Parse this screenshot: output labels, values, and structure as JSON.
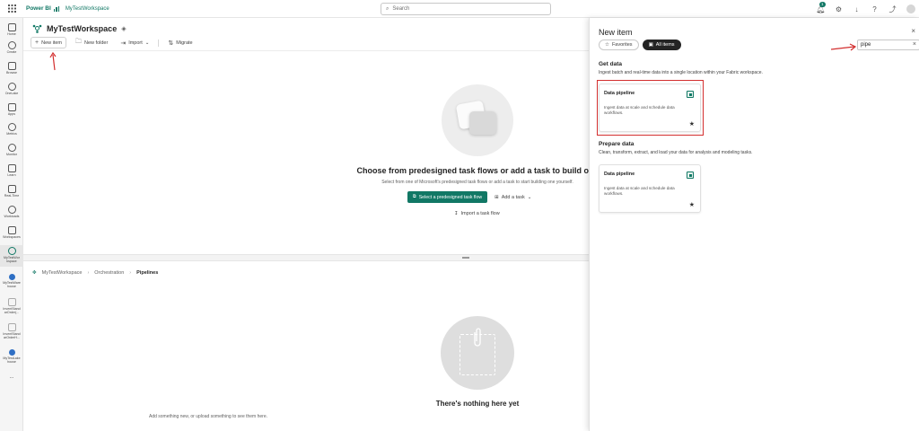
{
  "topbar": {
    "brand": "Power BI",
    "workspace_link": "MyTestWorkspace",
    "search_placeholder": "Search",
    "notification_count": "1"
  },
  "rail": [
    {
      "label": "Home"
    },
    {
      "label": "Create"
    },
    {
      "label": "Browse"
    },
    {
      "label": "OneLake"
    },
    {
      "label": "Apps"
    },
    {
      "label": "Metrics"
    },
    {
      "label": "Monitor"
    },
    {
      "label": "Learn"
    },
    {
      "label": "Real-Time"
    },
    {
      "label": "Workloads"
    },
    {
      "label": "Workspaces"
    },
    {
      "label": "MyTestWor kspace"
    },
    {
      "label": "MyTestWare house"
    },
    {
      "label": "InventStand arOrder(..."
    },
    {
      "label": "InventStand arOrderH..."
    },
    {
      "label": "MyTestLake house"
    },
    {
      "label": "..."
    }
  ],
  "workspace": {
    "title": "MyTestWorkspace",
    "toolbar": {
      "new_item": "New item",
      "new_folder": "New folder",
      "import": "Import",
      "migrate": "Migrate"
    },
    "hero": {
      "title": "Choose from predesigned task flows or add a task to build one",
      "subtitle": "Select from one of Microsoft's predesigned task flows or add a task to start building one yourself.",
      "select_button": "Select a predesigned task flow",
      "add_task": "Add a task",
      "import_flow": "Import a task flow"
    },
    "breadcrumb": {
      "root": "MyTestWorkspace",
      "middle": "Orchestration",
      "current": "Pipelines"
    },
    "empty": {
      "title": "There's nothing here yet",
      "subtitle": "Add something new, or upload something to see them here."
    }
  },
  "panel": {
    "title": "New item",
    "filters": {
      "favorites": "Favorites",
      "all_items": "All items"
    },
    "search_value": "pipe",
    "sections": [
      {
        "title": "Get data",
        "desc": "Ingest batch and real-time data into a single location within your Fabric workspace.",
        "card": {
          "name": "Data pipeline",
          "desc": "Ingest data at scale and schedule data workflows."
        }
      },
      {
        "title": "Prepare data",
        "desc": "Clean, transform, extract, and load your data for analysis and modeling tasks.",
        "card": {
          "name": "Data pipeline",
          "desc": "Ingest data at scale and schedule data workflows."
        }
      }
    ]
  },
  "colors": {
    "brand": "#117865",
    "annotation": "#d32f2f"
  }
}
